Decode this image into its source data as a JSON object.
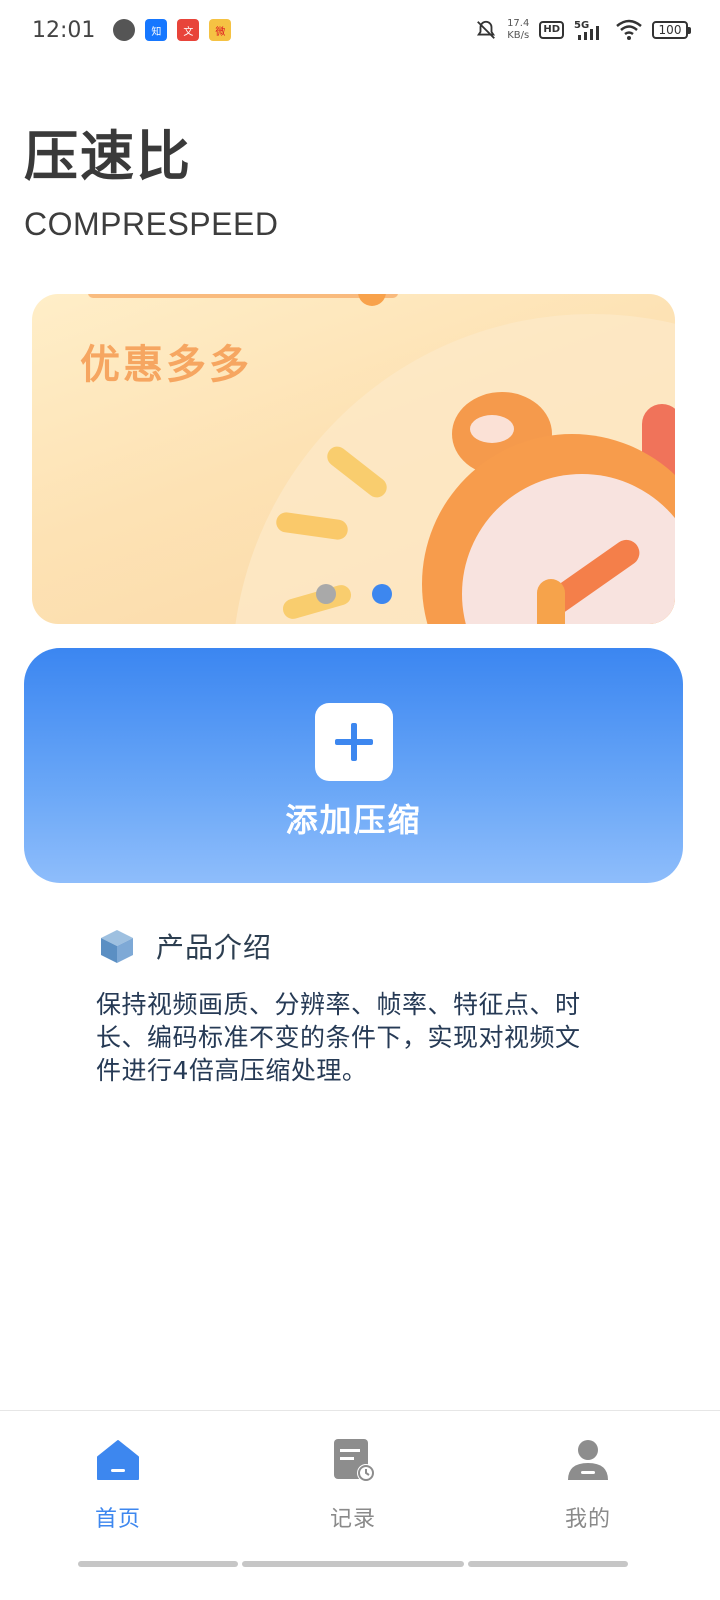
{
  "status_bar": {
    "time": "12:01",
    "net_speed_value": "17.4",
    "net_speed_unit": "KB/s",
    "hd": "HD",
    "network": "5G",
    "battery": "100",
    "app_icons": [
      "globe-icon",
      "zhihu-icon",
      "news-icon",
      "weibo-icon"
    ]
  },
  "header": {
    "title_cn": "压速比",
    "title_en": "COMPRESPEED"
  },
  "banner": {
    "text": "优惠多多",
    "pages": 2,
    "active_page": 2
  },
  "add_button": {
    "label": "添加压缩"
  },
  "intro": {
    "title": "产品介绍",
    "body": "保持视频画质、分辨率、帧率、特征点、时长、编码标准不变的条件下，实现对视频文件进行4倍高压缩处理。"
  },
  "bottom_nav": {
    "items": [
      {
        "label": "首页",
        "icon": "home-icon",
        "active": true
      },
      {
        "label": "记录",
        "icon": "records-icon",
        "active": false
      },
      {
        "label": "我的",
        "icon": "profile-icon",
        "active": false
      }
    ]
  },
  "colors": {
    "accent": "#3d87ef",
    "card_top": "#3b86f1",
    "card_bottom": "#8ebdfb",
    "nav_inactive": "#8a8a8a"
  }
}
